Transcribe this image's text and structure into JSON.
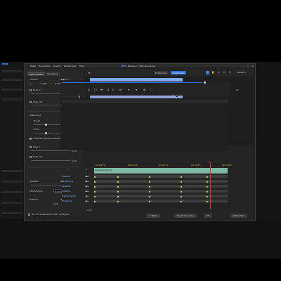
{
  "background_app": {
    "accent": "#2d74e0"
  },
  "menu": [
    "Datei",
    "Bearbeiten",
    "Ansicht",
    "Wiedergabe",
    "Hilfe"
  ],
  "window": {
    "app_name": "FX Designer",
    "separator": "|",
    "doc_title": "Hallowanderlee",
    "controls": [
      "–",
      "□",
      "✕"
    ]
  },
  "left_panel": {
    "tabs": [
      "Eigenschaften",
      "Bewegung"
    ],
    "position_label": "Position",
    "pos_x_label": "X",
    "pos_x": "0,500",
    "pos_y_label": "Y",
    "pos_y": "0,500",
    "ease_in_label": "Ease In",
    "ease_in_value": "0,00",
    "ease_out_label": "Ease Out",
    "ease_out_value": "0,00",
    "size_label": "Skalierung",
    "width_label": "Breite",
    "width_value": "0,100",
    "height_label": "Höhe",
    "height_value": "0,111",
    "keep_ratio_label": "Seitenverhältnis beibehalten",
    "ease_in2_label": "Ease In",
    "ease_in2_value": "0,00",
    "ease_out2_label": "Ease Out",
    "ease_out2_value": "0,00",
    "opacity_label": "Opazität",
    "opacity_value": "100%",
    "blend_label": "Mischmodus",
    "blend_value": "Normal",
    "rotation_label": "Rotation",
    "rotation_value": "0,00",
    "footer_label": "Nur die ausgewählte spur anzeigen"
  },
  "view_toolbar": {
    "left_label": "FX",
    "seg_a": "Einblenden",
    "seg_b": "Ausblenden",
    "zoom": "Passen"
  },
  "transport": {
    "buttons": [
      "▷",
      "□",
      "⏮",
      "◁",
      "▷",
      "⏭",
      "⇤",
      "⇥",
      "⊞",
      "⛶"
    ]
  },
  "timeline": {
    "timecodes": [
      "00:00:00",
      "00:00:05",
      "00:00:10",
      "00:00:15",
      "00:00:20"
    ],
    "clip_label": "Hallowanderung",
    "tracks": [
      "Position",
      "Skalierung",
      "Opazität",
      "Rotation",
      "Freiformende",
      "Endpunkt"
    ],
    "keyframe_pct": [
      0,
      18,
      42,
      66,
      86
    ]
  },
  "footer_buttons": {
    "share": "Teilen",
    "save_as": "Speichern unter",
    "ok": "OK",
    "cancel": "Abbrechen"
  }
}
